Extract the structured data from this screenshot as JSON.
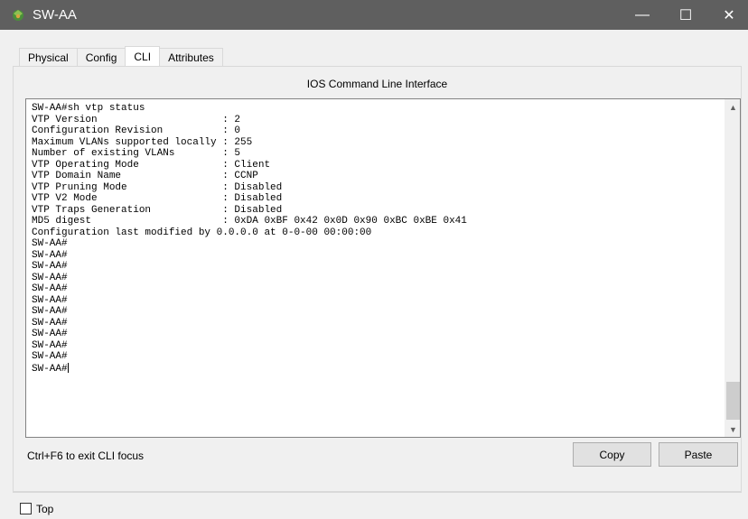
{
  "window": {
    "title": "SW-AA",
    "icon": "packet-tracer-device-icon",
    "minimize_glyph": "—",
    "maximize_glyph": "☐",
    "close_glyph": "✕"
  },
  "tabs": [
    {
      "label": "Physical"
    },
    {
      "label": "Config"
    },
    {
      "label": "CLI"
    },
    {
      "label": "Attributes"
    }
  ],
  "active_tab": "CLI",
  "cli": {
    "header": "IOS Command Line Interface",
    "lines": [
      "SW-AA#sh vtp status",
      "VTP Version                     : 2",
      "Configuration Revision          : 0",
      "Maximum VLANs supported locally : 255",
      "Number of existing VLANs        : 5",
      "VTP Operating Mode              : Client",
      "VTP Domain Name                 : CCNP",
      "VTP Pruning Mode                : Disabled",
      "VTP V2 Mode                     : Disabled",
      "VTP Traps Generation            : Disabled",
      "MD5 digest                      : 0xDA 0xBF 0x42 0x0D 0x90 0xBC 0xBE 0x41",
      "Configuration last modified by 0.0.0.0 at 0-0-00 00:00:00",
      "SW-AA#",
      "SW-AA#",
      "SW-AA#",
      "SW-AA#",
      "SW-AA#",
      "SW-AA#",
      "SW-AA#",
      "SW-AA#",
      "SW-AA#",
      "SW-AA#",
      "SW-AA#",
      "SW-AA#"
    ],
    "scroll_up_glyph": "▲",
    "scroll_down_glyph": "▼",
    "focus_hint": "Ctrl+F6 to exit CLI focus",
    "copy_label": "Copy",
    "paste_label": "Paste"
  },
  "footer": {
    "top_checkbox_label": "Top",
    "top_checked": false
  },
  "colors": {
    "titlebar": "#5f5f5f",
    "window_bg": "#f0f0f0",
    "terminal_bg": "#ffffff",
    "button_bg": "#e1e1e1"
  }
}
